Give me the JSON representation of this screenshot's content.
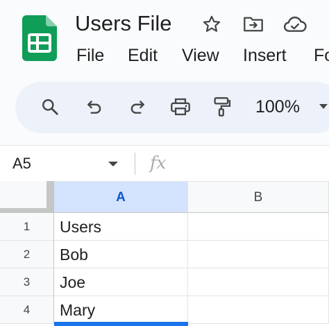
{
  "header": {
    "title": "Users File",
    "icons": [
      "star-icon",
      "move-to-folder-icon",
      "cloud-saved-icon"
    ]
  },
  "menu": [
    "File",
    "Edit",
    "View",
    "Insert",
    "Fo"
  ],
  "toolbar": {
    "icons": [
      "search-icon",
      "undo-icon",
      "redo-icon",
      "print-icon",
      "paint-format-icon"
    ],
    "zoom": "100%"
  },
  "formula_bar": {
    "name_box": "A5",
    "fx_symbol": "fx"
  },
  "grid": {
    "columns": [
      "A",
      "B"
    ],
    "rows": [
      {
        "num": "1",
        "a": "Users",
        "b": ""
      },
      {
        "num": "2",
        "a": "Bob",
        "b": ""
      },
      {
        "num": "3",
        "a": "Joe",
        "b": ""
      },
      {
        "num": "4",
        "a": "Mary",
        "b": ""
      }
    ],
    "selected_column": "A"
  },
  "colors": {
    "sheets_green": "#0f9d58",
    "selection_blue": "#1a73e8",
    "selected_header_bg": "#d3e3fd"
  }
}
